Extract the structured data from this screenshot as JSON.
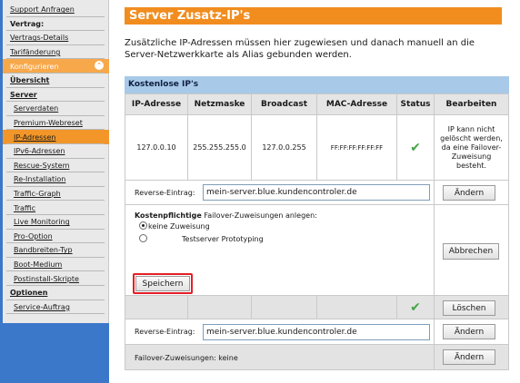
{
  "sidebar": {
    "items": [
      {
        "label": "Support Anfragen",
        "kind": "link"
      },
      {
        "label": "Vertrag:",
        "kind": "head"
      },
      {
        "label": "Vertrags-Details",
        "kind": "link"
      },
      {
        "label": "Tarifänderung",
        "kind": "link"
      },
      {
        "label": "Konfigurieren",
        "kind": "active"
      },
      {
        "label": "Übersicht",
        "kind": "headul"
      },
      {
        "label": "Server",
        "kind": "headul"
      },
      {
        "label": "Serverdaten",
        "kind": "sub"
      },
      {
        "label": "Premium-Webreset",
        "kind": "sub"
      },
      {
        "label": "IP-Adressen",
        "kind": "selected"
      },
      {
        "label": "IPv6-Adressen",
        "kind": "sub"
      },
      {
        "label": "Rescue-System",
        "kind": "sub"
      },
      {
        "label": "Re-Installation",
        "kind": "sub"
      },
      {
        "label": "Traffic-Graph",
        "kind": "sub"
      },
      {
        "label": "Traffic",
        "kind": "sub"
      },
      {
        "label": "Live Monitoring",
        "kind": "sub"
      },
      {
        "label": "Pro-Option",
        "kind": "sub"
      },
      {
        "label": "Bandbreiten-Typ",
        "kind": "sub"
      },
      {
        "label": "Boot-Medium",
        "kind": "sub"
      },
      {
        "label": "Postinstall-Skripte",
        "kind": "sub"
      },
      {
        "label": "Optionen",
        "kind": "headul"
      },
      {
        "label": "Service-Auftrag",
        "kind": "sub"
      }
    ]
  },
  "page": {
    "title": "Server Zusatz-IP's",
    "intro": "Zusätzliche IP-Adressen müssen hier zugewiesen und danach manuell an die Server-Netzwerkkarte als Alias gebunden werden.",
    "section_title": "Kostenlose IP's"
  },
  "table": {
    "headers": [
      "IP-Adresse",
      "Netzmaske",
      "Broadcast",
      "MAC-Adresse",
      "Status",
      "Bearbeiten"
    ],
    "row1": {
      "ip": "127.0.0.10",
      "netmask": "255.255.255.0",
      "broadcast": "127.0.0.255",
      "mac": "FF:FF:FF:FF:FF:FF",
      "status_icon": "check-icon",
      "note": "IP kann nicht gelöscht werden, da eine Failover-Zuweisung besteht."
    },
    "reverse1": {
      "label": "Reverse-Eintrag:",
      "value": "mein-server.blue.kundencontroler.de",
      "button": "Ändern"
    },
    "failover_form": {
      "title_bold": "Kostenpflichtige",
      "title_rest": " Failover-Zuweisungen anlegen:",
      "options": [
        "keine Zuweisung",
        "Testserver Prototyping"
      ],
      "selected_index": 0,
      "cancel_button": "Abbrechen",
      "save_button": "Speichern"
    },
    "row2": {
      "status_icon": "check-icon",
      "button": "Löschen"
    },
    "reverse2": {
      "label": "Reverse-Eintrag:",
      "value": "mein-server.blue.kundencontroler.de",
      "button": "Ändern"
    },
    "failover_status": {
      "label": "Failover-Zuweisungen: keine",
      "button": "Ändern"
    }
  },
  "colors": {
    "accent": "#f18d1f",
    "section": "#a8c9e8",
    "frame": "#3b78c9",
    "highlight": "#e41e26",
    "check": "#46a546"
  }
}
